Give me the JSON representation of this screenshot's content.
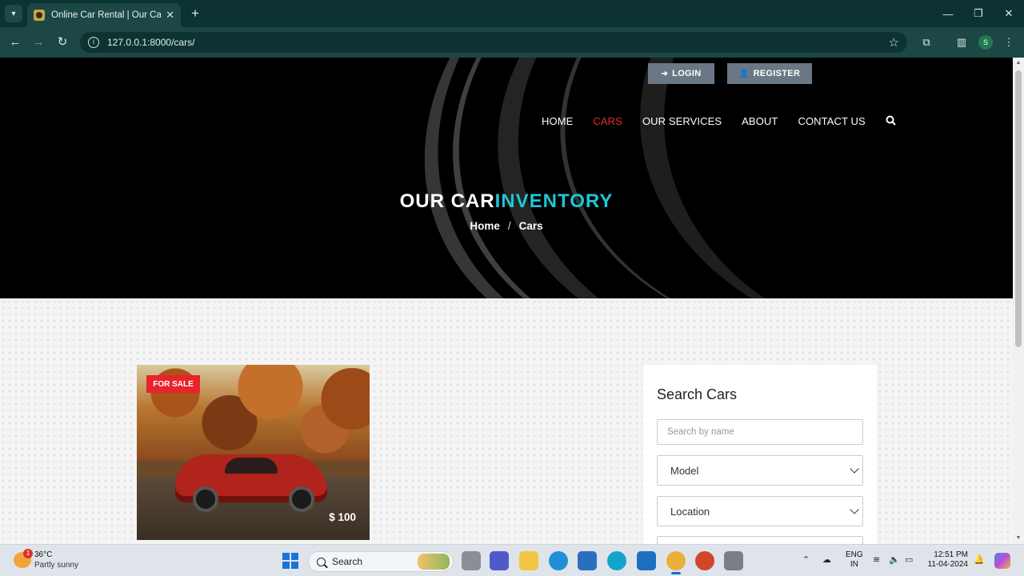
{
  "browser": {
    "tab_title": "Online Car Rental | Our Cars Inv",
    "tab_close": "✕",
    "new_tab": "+",
    "url": "127.0.0.1:8000/cars/",
    "profile_initial": "S",
    "window_controls": {
      "minimize": "—",
      "maximize": "❐",
      "close": "✕"
    }
  },
  "header": {
    "login_label": "LOGIN",
    "register_label": "REGISTER",
    "nav": [
      {
        "label": "HOME",
        "active": false
      },
      {
        "label": "CARS",
        "active": true
      },
      {
        "label": "OUR SERVICES",
        "active": false
      },
      {
        "label": "ABOUT",
        "active": false
      },
      {
        "label": "CONTACT US",
        "active": false
      }
    ],
    "nav_active_color": "#e22b2b"
  },
  "hero": {
    "title_main": "OUR CAR",
    "title_accent": "INVENTORY",
    "accent_color": "#1fc6d6",
    "breadcrumb_home": "Home",
    "breadcrumb_sep": "/",
    "breadcrumb_current": "Cars"
  },
  "car_card": {
    "badge": "FOR SALE",
    "badge_color": "#e8232b",
    "price": "$ 100"
  },
  "search_widget": {
    "title": "Search Cars",
    "name_placeholder": "Search by name",
    "model_label": "Model",
    "location_label": "Location"
  },
  "taskbar": {
    "weather_temp": "36°C",
    "weather_desc": "Partly sunny",
    "weather_badge": "1",
    "search_label": "Search",
    "lang_top": "ENG",
    "lang_bottom": "IN",
    "time": "12:51 PM",
    "date": "11-04-2024"
  }
}
